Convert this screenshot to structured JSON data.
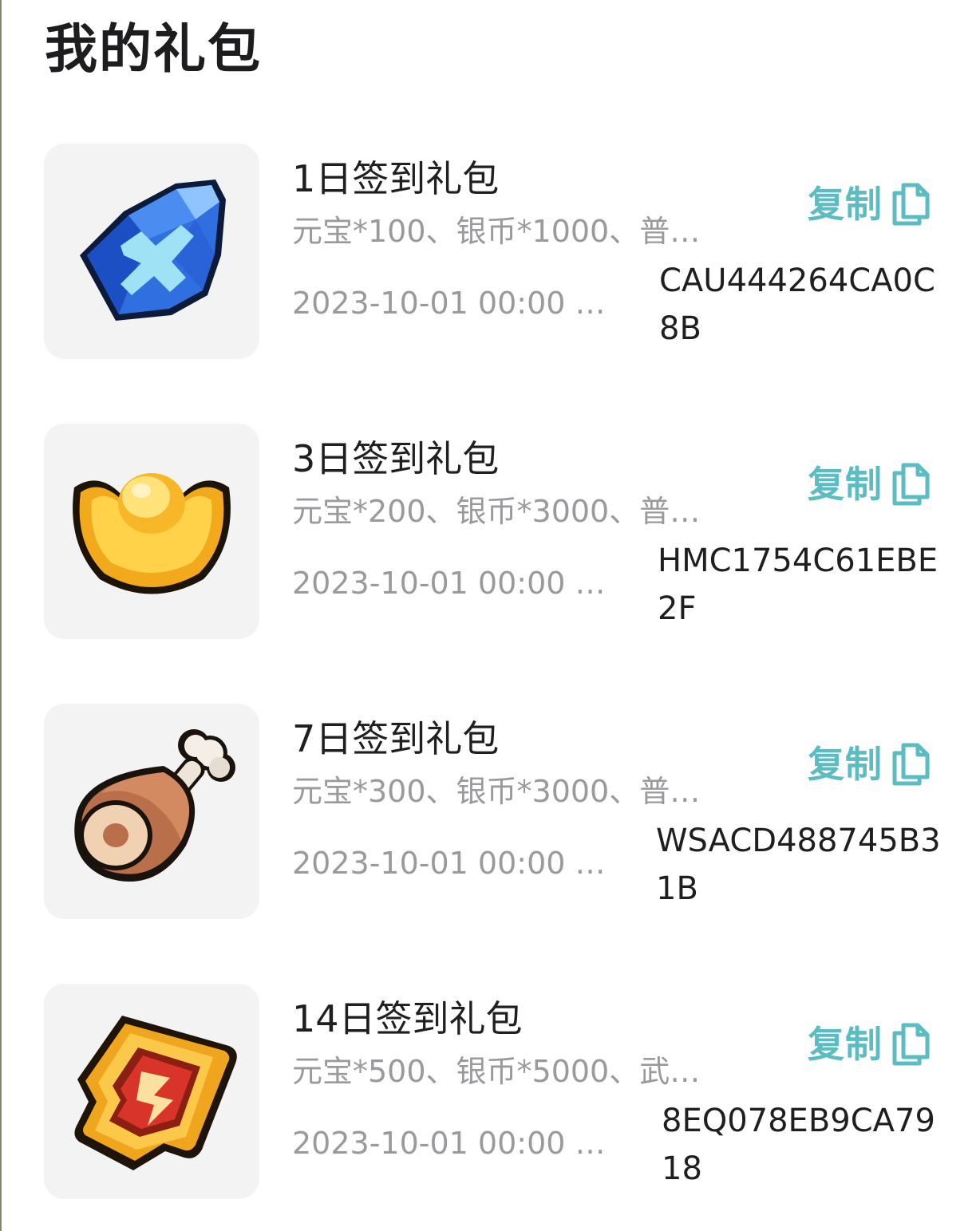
{
  "page": {
    "title": "我的礼包"
  },
  "theme": {
    "accent": "#5bbcc2",
    "text_primary": "#1f1f22",
    "text_secondary": "#9a9a9e",
    "thumb_bg": "#f3f3f4"
  },
  "gifts": [
    {
      "name": "1日签到礼包",
      "content": "元宝*100、银币*1000、普…",
      "expiry": "2023-10-01 00:00 前…",
      "code": "CAU444264CA0C8B",
      "copy_label": "复制",
      "icon": "blue-crystal-sword-icon"
    },
    {
      "name": "3日签到礼包",
      "content": "元宝*200、银币*3000、普…",
      "expiry": "2023-10-01 00:00 前…",
      "code": "HMC1754C61EBE2F",
      "copy_label": "复制",
      "icon": "gold-ingot-icon"
    },
    {
      "name": "7日签到礼包",
      "content": "元宝*300、银币*3000、普…",
      "expiry": "2023-10-01 00:00 前…",
      "code": "WSACD488745B31B",
      "copy_label": "复制",
      "icon": "ham-leg-icon"
    },
    {
      "name": "14日签到礼包",
      "content": "元宝*500、银币*5000、武…",
      "expiry": "2023-10-01 00:00 前…",
      "code": "8EQ078EB9CA7918",
      "copy_label": "复制",
      "icon": "weapon-token-icon"
    }
  ]
}
